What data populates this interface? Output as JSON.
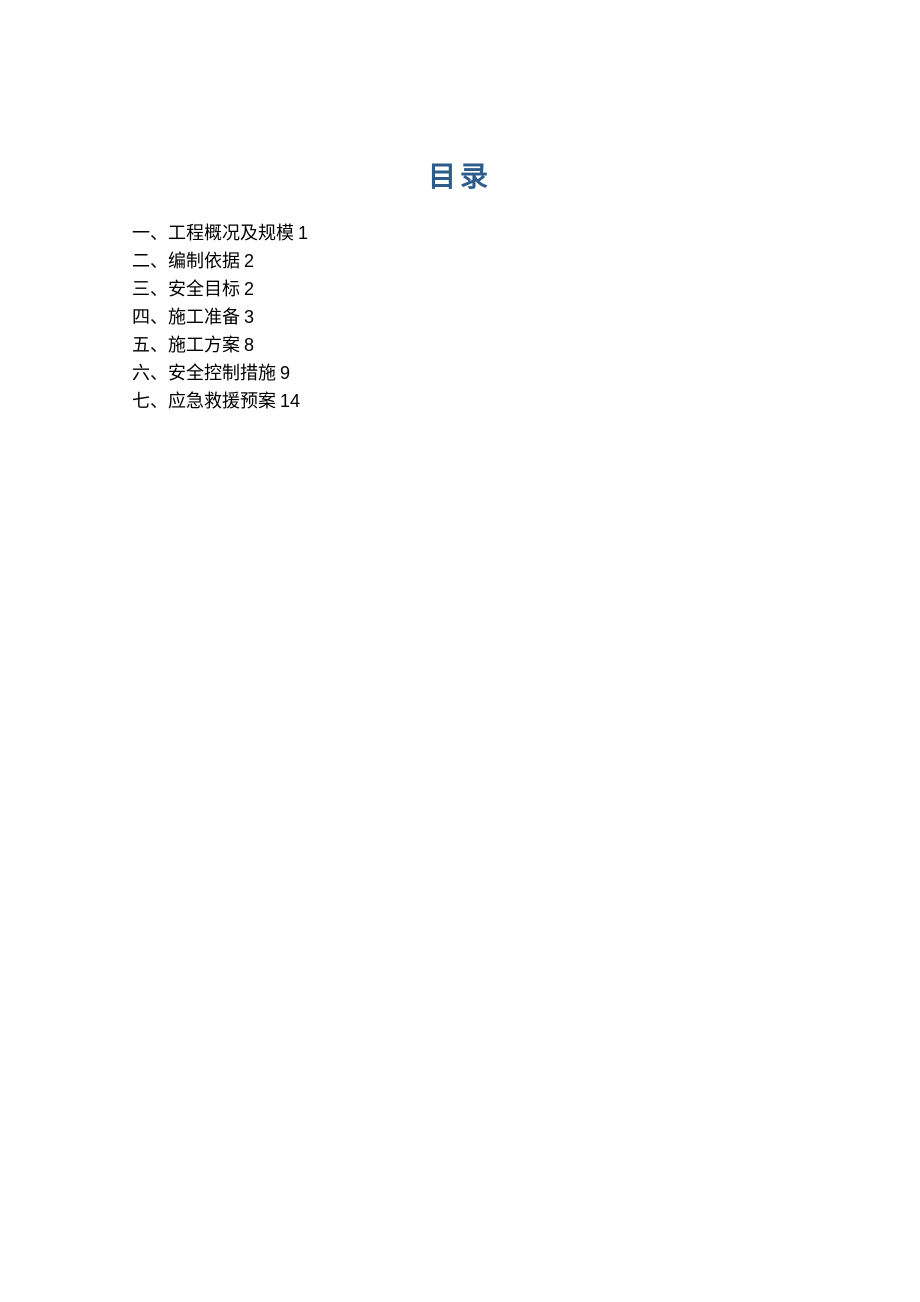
{
  "title": "目录",
  "toc": [
    {
      "label": "一、工程概况及规模",
      "page": "1"
    },
    {
      "label": "二、编制依据",
      "page": "2"
    },
    {
      "label": "三、安全目标",
      "page": "2"
    },
    {
      "label": "四、施工准备",
      "page": "3"
    },
    {
      "label": "五、施工方案",
      "page": "8"
    },
    {
      "label": "六、安全控制措施",
      "page": "9"
    },
    {
      "label": "七、应急救援预案",
      "page": "14"
    }
  ]
}
